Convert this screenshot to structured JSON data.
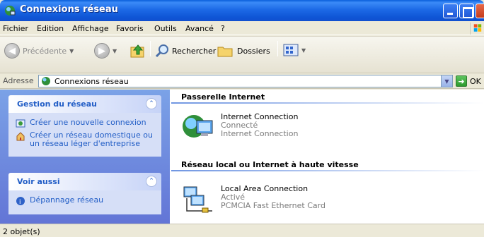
{
  "window": {
    "title": "Connexions réseau"
  },
  "menu": [
    "Fichier",
    "Edition",
    "Affichage",
    "Favoris",
    "Outils",
    "Avancé",
    "?"
  ],
  "toolbar": {
    "back_label": "Précédente",
    "search_label": "Rechercher",
    "folders_label": "Dossiers"
  },
  "address": {
    "label": "Adresse",
    "value": "Connexions réseau",
    "go_label": "OK"
  },
  "taskpane": {
    "network_tasks": {
      "title": "Gestion du réseau",
      "items": [
        {
          "label": "Créer une nouvelle connexion"
        },
        {
          "label": "Créer un réseau domestique ou un réseau léger d'entreprise"
        }
      ]
    },
    "see_also": {
      "title": "Voir aussi",
      "items": [
        {
          "label": "Dépannage réseau"
        }
      ]
    }
  },
  "groups": [
    {
      "title": "Passerelle Internet",
      "items": [
        {
          "name": "Internet Connection",
          "status": "Connecté",
          "device": "Internet Connection"
        }
      ]
    },
    {
      "title": "Réseau local ou Internet à haute vitesse",
      "items": [
        {
          "name": "Local Area Connection",
          "status": "Activé",
          "device": "PCMCIA Fast Ethernet Card"
        }
      ]
    }
  ],
  "status": {
    "text": "2 objet(s)"
  }
}
